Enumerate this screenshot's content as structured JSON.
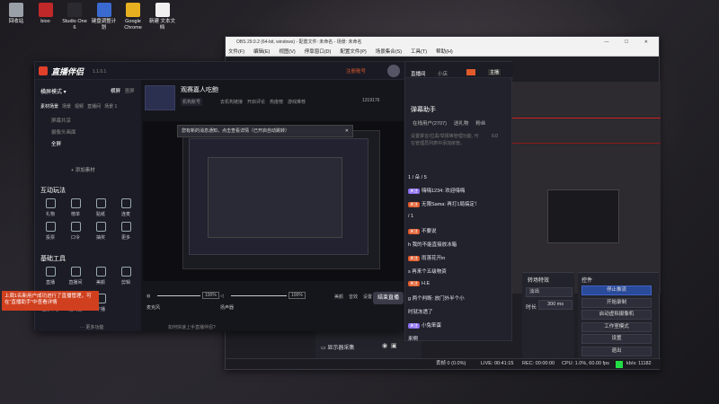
{
  "desktop": {
    "icons": [
      {
        "label": "回收站",
        "icon": "recycle-bin-icon",
        "color": "#9aa0a8"
      },
      {
        "label": "bioo",
        "icon": "bioo-icon",
        "color": "#c0282a"
      },
      {
        "label": "Studio One 6",
        "icon": "studio-one-icon",
        "color": "#2a2a30"
      },
      {
        "label": "键盘调整计划",
        "icon": "keyboard-icon",
        "color": "#3a6ad0"
      },
      {
        "label": "Google Chrome",
        "icon": "chrome-icon",
        "color": "#e6b020"
      },
      {
        "label": "新建 文本文档",
        "icon": "text-file-icon",
        "color": "#f0f0f0"
      }
    ]
  },
  "obs": {
    "title": "OBS 29.0.2 (64-bit, windows) - 配置文件: 未命名 - 场景: 未命名",
    "menu": [
      "文件(F)",
      "编辑(E)",
      "视图(V)",
      "停靠窗口(D)",
      "配置文件(P)",
      "场景集合(S)",
      "工具(T)",
      "帮助(H)"
    ],
    "docks": {
      "transitions_title": "转场特效",
      "transition_value": "淡出",
      "duration_label": "时长",
      "duration_value": "300 ms",
      "controls_title": "控件",
      "controls": [
        "停止推流",
        "开始录制",
        "启动虚拟摄像机",
        "工作室模式",
        "设置",
        "退出"
      ]
    },
    "sources": [
      {
        "name": "显示器采集"
      }
    ],
    "status": {
      "dropped": "丢帧 0 (0.0%)",
      "live": "LIVE: 00:41:15",
      "rec": "REC: 00:00:00",
      "cpu": "CPU: 1.0%, 60.00 fps",
      "kbps": "kb/s: 11182"
    },
    "accent": "#3e62c4"
  },
  "live": {
    "logo": "直播伴侣",
    "version": "1.1.0.1",
    "mode": "横屏模式",
    "tabs": [
      "横屏",
      "竖屏"
    ],
    "scene_tabs": [
      "素材场景",
      "场景",
      "视频",
      "直播间",
      "场景 1"
    ],
    "scenes": [
      "屏幕共享",
      "摄像头画面",
      "全屏"
    ],
    "add_material": "+ 添加素材",
    "interaction_title": "互动玩法",
    "interaction_tools": [
      "礼物",
      "榜单",
      "贴纸",
      "连麦",
      "投票",
      "口令",
      "抽奖",
      "更多"
    ],
    "basic_tools_title": "基础工具",
    "basic_tools": [
      "直播",
      "直播间",
      "美颜",
      "剪辑",
      "任务中心",
      "提词器",
      "下播"
    ],
    "more_label": "··· 更多功能",
    "room_title": "观赛嘉人吃鲍",
    "room_sub": "机构账号",
    "room_tags": [
      "去机构链接",
      "开启评论",
      "热度榜",
      "游戏推荐"
    ],
    "viewer_count": "1319176",
    "live_badge": "直播中",
    "tip_text": "您有新的消息通知，点击查看详情（已开启自动跳转）",
    "mic_label": "麦克风",
    "mic_value": "100%",
    "speaker_label": "扬声器",
    "speaker_value": "100%",
    "bottom_actions": [
      "美颜",
      "音效",
      "设置"
    ],
    "end_button": "结束直播",
    "footer_note": "如何快速上手直播伴侣?",
    "notify_label": "注册账号",
    "notice": "上周1名新用户成功进行了直播管理，可在“直播助手”中查看详情"
  },
  "chat": {
    "top_tabs": [
      "直播间",
      "小店"
    ],
    "invite_label": "主播",
    "title": "弹幕助手",
    "sub_tabs": [
      "在线用户(2707)",
      "送礼物",
      "粉丝"
    ],
    "note": "设置禁言/拉黑/举报等管理功能, 可在管理员列表中添加房管。",
    "counter": "0.0",
    "messages": [
      {
        "text": "1 / 朵 / 5"
      },
      {
        "tag": "关注",
        "text": "嗨嗨1234: 欢迎嗨嗨"
      },
      {
        "tag": "关注",
        "text": "无限Sama: 再打1局搞定！"
      },
      {
        "text": "/ 1"
      },
      {
        "tag": "关注",
        "text": "不要说"
      },
      {
        "text": "h 我的不能直接放冰箱"
      },
      {
        "tag": "关注",
        "text": "雨落花开in"
      },
      {
        "text": "s 再来个五级物资"
      },
      {
        "tag": "关注",
        "text": "H.E"
      },
      {
        "text": "g 两个判断: 放门外半个小"
      },
      {
        "text": "时就冻透了"
      },
      {
        "tag": "关注",
        "text": "小兔笨蛋"
      },
      {
        "text": "来啊"
      }
    ]
  }
}
